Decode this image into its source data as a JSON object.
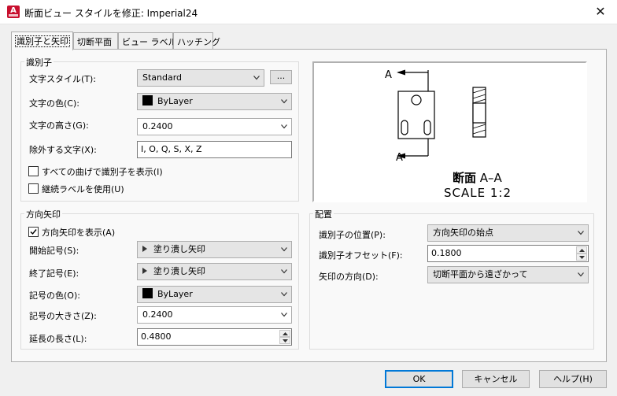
{
  "window": {
    "title": "断面ビュー スタイルを修正: Imperial24",
    "close_glyph": "✕",
    "app_icon_letter": "A"
  },
  "tabs": [
    {
      "label": "識別子と矢印"
    },
    {
      "label": "切断平面"
    },
    {
      "label": "ビュー ラベル"
    },
    {
      "label": "ハッチング"
    }
  ],
  "identifier": {
    "legend": "識別子",
    "text_style": {
      "label": "文字スタイル(T):",
      "value": "Standard",
      "browse_label": "..."
    },
    "text_color": {
      "label": "文字の色(C):",
      "value": "ByLayer"
    },
    "text_height": {
      "label": "文字の高さ(G):",
      "value": "0.2400"
    },
    "exclude_chars": {
      "label": "除外する文字(X):",
      "value": "I, O, Q, S, X, Z"
    },
    "show_at_every_bend": {
      "label": "すべての曲げで識別子を表示(I)",
      "checked": false
    },
    "continuous_labels": {
      "label": "継続ラベルを使用(U)",
      "checked": false
    }
  },
  "arrows": {
    "legend": "方向矢印",
    "show_arrows": {
      "label": "方向矢印を表示(A)",
      "checked": true
    },
    "start_symbol": {
      "label": "開始記号(S):",
      "value": "塗り潰し矢印"
    },
    "end_symbol": {
      "label": "終了記号(E):",
      "value": "塗り潰し矢印"
    },
    "symbol_color": {
      "label": "記号の色(O):",
      "value": "ByLayer"
    },
    "symbol_size": {
      "label": "記号の大きさ(Z):",
      "value": "0.2400"
    },
    "extension_length": {
      "label": "延長の長さ(L):",
      "value": "0.4800"
    }
  },
  "preview": {
    "identifier_letter": "A",
    "caption_bold": "断面",
    "caption_rest": "A–A",
    "scale_text": "SCALE 1:2"
  },
  "placement": {
    "legend": "配置",
    "identifier_position": {
      "label": "識別子の位置(P):",
      "value": "方向矢印の始点"
    },
    "identifier_offset": {
      "label": "識別子オフセット(F):",
      "value": "0.1800"
    },
    "arrow_direction": {
      "label": "矢印の方向(D):",
      "value": "切断平面から遠ざかって"
    }
  },
  "buttons": {
    "ok": "OK",
    "cancel": "キャンセル",
    "help": "ヘルプ(H)"
  },
  "colors": {
    "accent": "#0078d7",
    "app_icon": "#c8102e",
    "preview_line": "#000000"
  }
}
